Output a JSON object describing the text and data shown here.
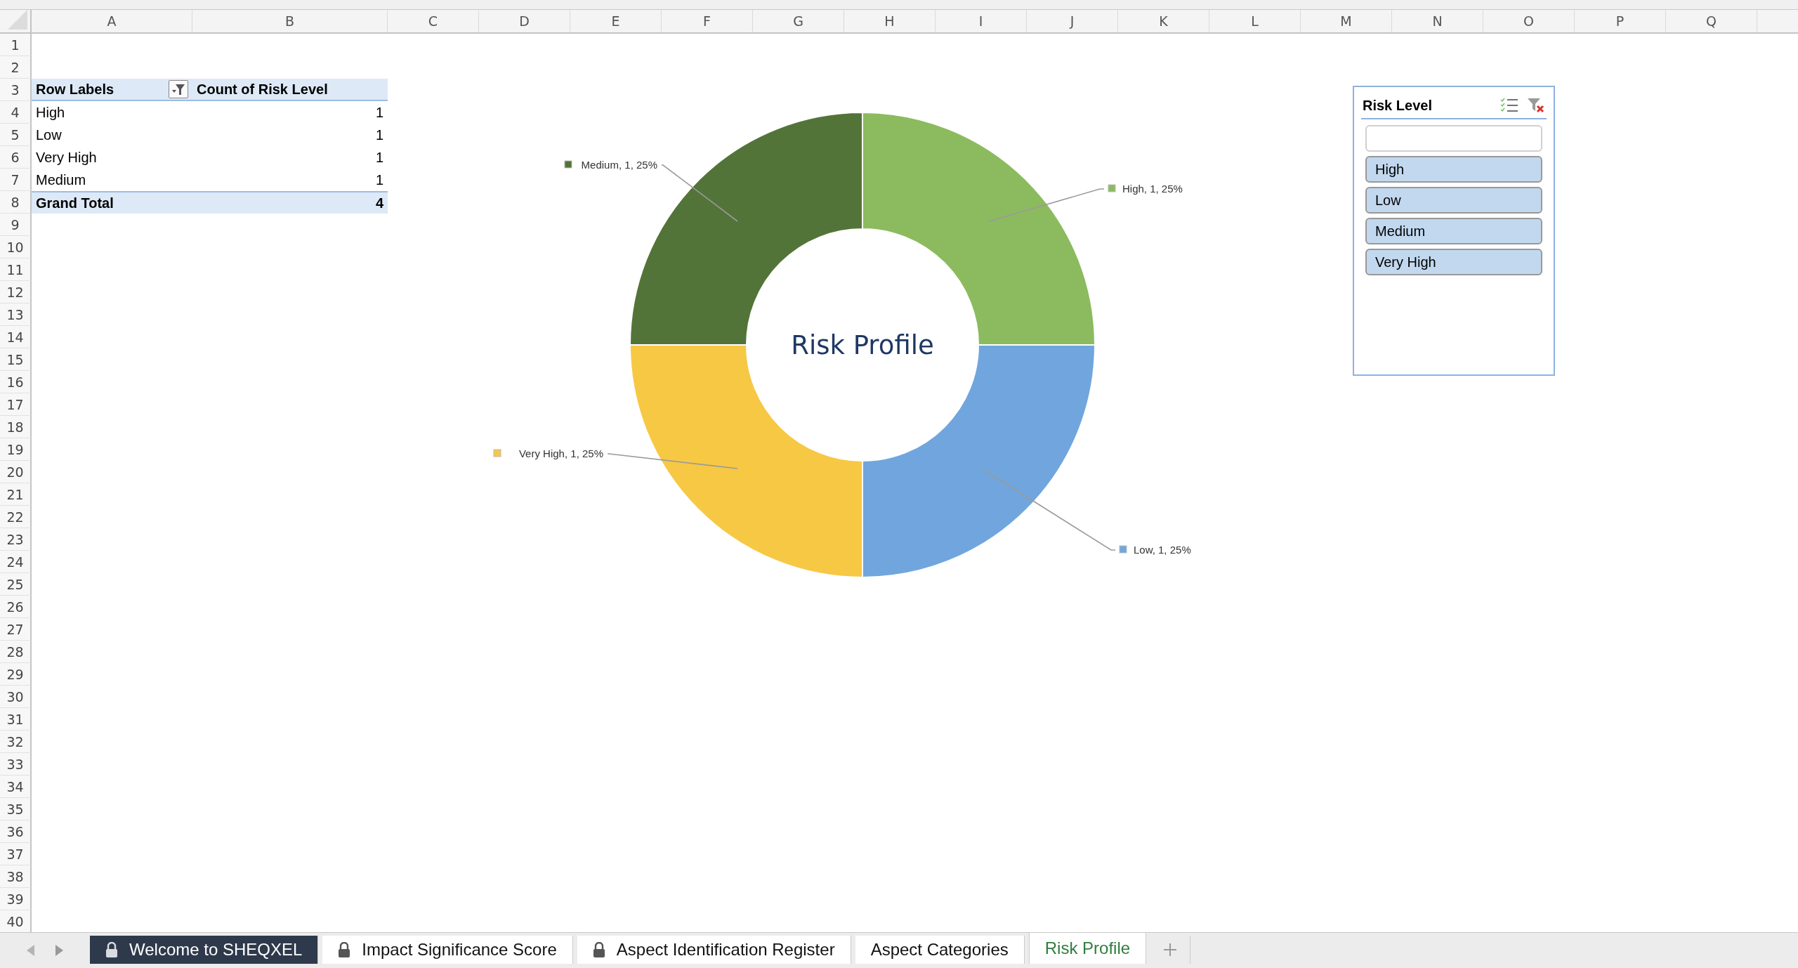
{
  "columns": [
    "A",
    "B",
    "C",
    "D",
    "E",
    "F",
    "G",
    "H",
    "I",
    "J",
    "K",
    "L",
    "M",
    "N",
    "O",
    "P",
    "Q"
  ],
  "row_numbers": [
    "1",
    "2",
    "3",
    "4",
    "5",
    "6",
    "7",
    "8",
    "9",
    "10",
    "11",
    "12",
    "13",
    "14",
    "15",
    "16",
    "17",
    "18",
    "19",
    "20",
    "21",
    "22",
    "23",
    "24",
    "25",
    "26",
    "27",
    "28",
    "29",
    "30",
    "31",
    "32",
    "33",
    "34",
    "35",
    "36",
    "37",
    "38",
    "39",
    "40"
  ],
  "pivot": {
    "header_row_labels": "Row Labels",
    "header_value": "Count of Risk Level",
    "rows": [
      {
        "label": "High",
        "count": "1"
      },
      {
        "label": "Low",
        "count": "1"
      },
      {
        "label": "Very High",
        "count": "1"
      },
      {
        "label": "Medium",
        "count": "1"
      }
    ],
    "total": {
      "label": "Grand Total",
      "count": "4"
    }
  },
  "chart": {
    "chart_data": {
      "type": "donut",
      "title": "Risk Profile",
      "values": [
        1,
        1,
        1,
        1
      ],
      "data_labels": true,
      "value_labels": [
        "High, 1, 25%",
        "Low, 1, 25%",
        "Very High, 1, 25%",
        "Medium, 1, 25%"
      ]
    },
    "slices": [
      {
        "color": "#8bbb5e"
      },
      {
        "color": "#70a6dd"
      },
      {
        "color": "#f7c844"
      },
      {
        "color": "#537438"
      }
    ]
  },
  "slicer": {
    "title": "Risk Level",
    "items": [
      {
        "label": "High",
        "selected": true
      },
      {
        "label": "Low",
        "selected": true
      },
      {
        "label": "Medium",
        "selected": true
      },
      {
        "label": "Very High",
        "selected": true
      }
    ]
  },
  "sheet_tabs": [
    {
      "label": "Welcome to SHEQXEL",
      "locked": true,
      "selected": false,
      "color": "#2e3a4b"
    },
    {
      "label": "Impact Significance Score",
      "locked": true,
      "selected": false
    },
    {
      "label": "Aspect Identification Register",
      "locked": true,
      "selected": false
    },
    {
      "label": "Aspect Categories",
      "locked": false,
      "selected": false
    },
    {
      "label": "Risk Profile",
      "locked": false,
      "selected": true
    }
  ]
}
